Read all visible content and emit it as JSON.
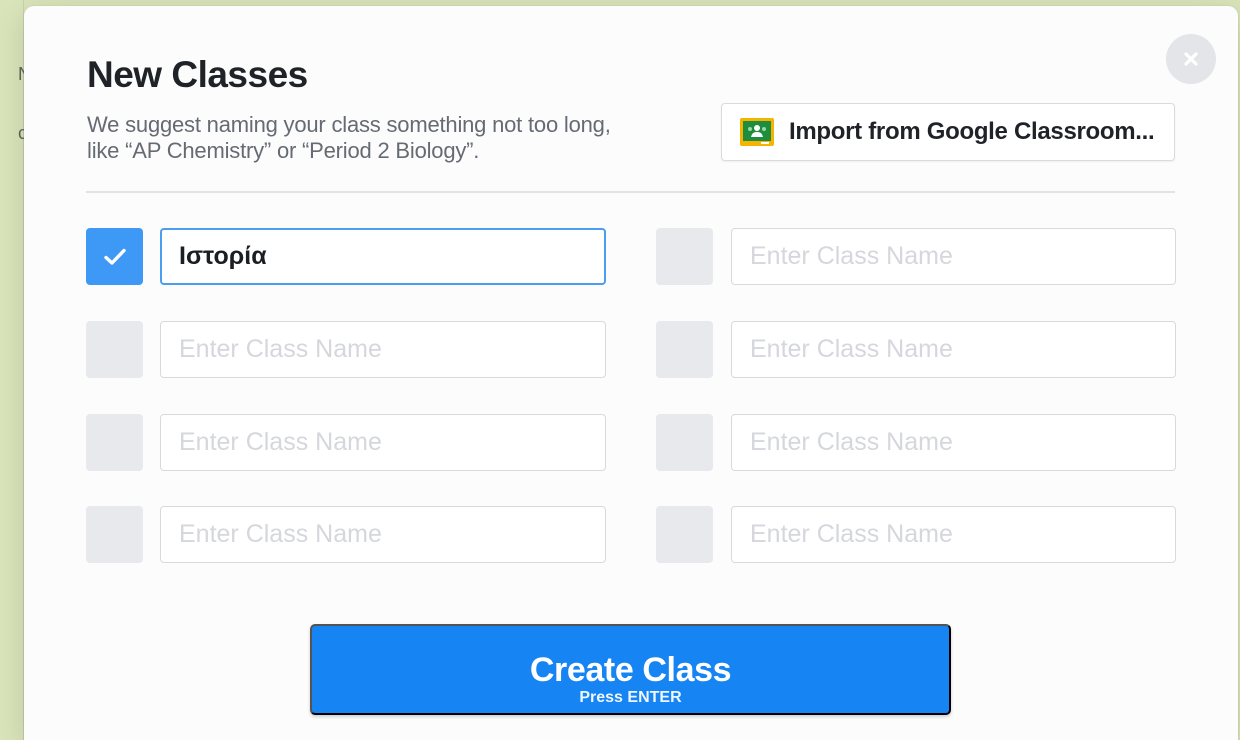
{
  "background": {
    "letters": [
      "N",
      "c"
    ]
  },
  "modal": {
    "title": "New Classes",
    "subtitle": "We suggest naming your class something not too long, like “AP Chemistry” or “Period 2 Biology”.",
    "import_label": "Import from Google Classroom...",
    "icons": {
      "close": "close-icon",
      "import": "google-classroom-icon",
      "checked": "check-icon"
    },
    "colors": {
      "accent": "#1684F2",
      "checked": "#3D99F5",
      "google_green": "#1E8E3E",
      "google_yellow": "#F4B400"
    },
    "rows": [
      [
        {
          "checked": true,
          "value": "Ιστορία",
          "placeholder": "Enter Class Name"
        },
        {
          "checked": false,
          "value": "",
          "placeholder": "Enter Class Name"
        }
      ],
      [
        {
          "checked": false,
          "value": "",
          "placeholder": "Enter Class Name"
        },
        {
          "checked": false,
          "value": "",
          "placeholder": "Enter Class Name"
        }
      ],
      [
        {
          "checked": false,
          "value": "",
          "placeholder": "Enter Class Name"
        },
        {
          "checked": false,
          "value": "",
          "placeholder": "Enter Class Name"
        }
      ],
      [
        {
          "checked": false,
          "value": "",
          "placeholder": "Enter Class Name"
        },
        {
          "checked": false,
          "value": "",
          "placeholder": "Enter Class Name"
        }
      ]
    ],
    "create_label": "Create Class",
    "create_hint": "Press ENTER"
  }
}
